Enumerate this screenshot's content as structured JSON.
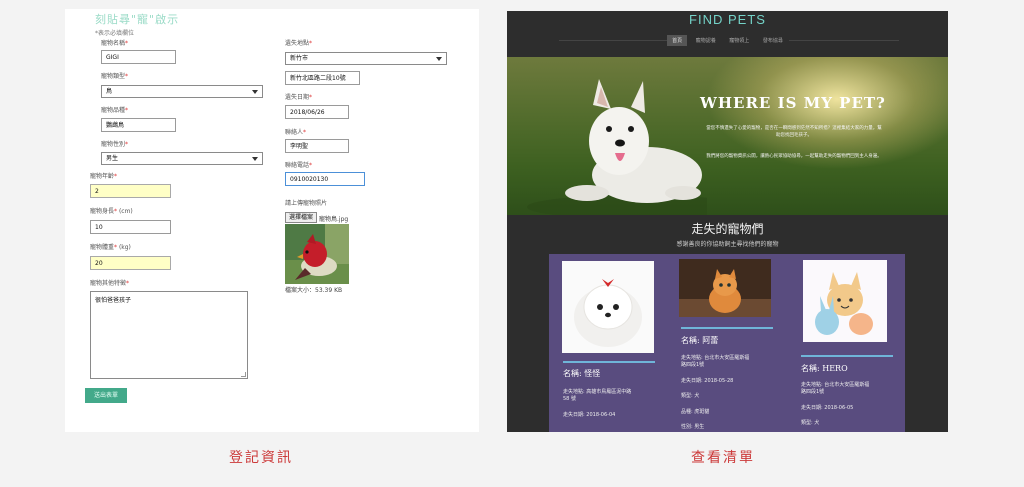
{
  "form": {
    "title": "刻貼尋\"寵\"啟示",
    "required_note": "*表示必填欄位",
    "pet_name": {
      "label": "寵物名稱",
      "value": "GIGI"
    },
    "pet_type": {
      "label": "寵物類型",
      "value": "鳥"
    },
    "pet_breed": {
      "label": "寵物品種",
      "value": "鸚鵡鳥"
    },
    "pet_gender": {
      "label": "寵物性別",
      "value": "男生"
    },
    "pet_age": {
      "label": "寵物年齡",
      "value": "2"
    },
    "pet_height": {
      "label": "寵物身長",
      "unit": "(cm)",
      "value": "10"
    },
    "pet_weight": {
      "label": "寵物體重",
      "unit": "(kg)",
      "value": "20"
    },
    "pet_features": {
      "label": "寵物其他特徵",
      "value": "很怕爸爸孩子"
    },
    "lost_location": {
      "label": "遺失地點",
      "city": "新竹市",
      "address": "新竹北區路二段10號"
    },
    "lost_date": {
      "label": "遺失日期",
      "value": "2018/06/26"
    },
    "contact_name": {
      "label": "聯絡人",
      "value": "李明聖"
    },
    "contact_phone": {
      "label": "聯絡電話",
      "value": "0910020130"
    },
    "photo": {
      "label": "請上傳寵物照片",
      "button": "選擇檔案",
      "filename": "寵物鳥.jpg",
      "size": "檔案大小：53.39 KB"
    },
    "submit": "送出表單",
    "required_mark": "*"
  },
  "site": {
    "logo": "FIND PETS",
    "nav": [
      "首頁",
      "寵物認養",
      "寵物領上",
      "發布協尋"
    ],
    "hero_title": "WHERE IS MY PET?",
    "hero_text_1": "當您不慎遺失了心愛的寵物，是否在一瞬間感到茫然不知所措？這裡集結大家的力量，幫助您找回毛孩子。",
    "hero_text_2": "我們將您的寵物資訊公開，讓熱心民眾協助協尋，一起幫助走失的寵物們回到主人身邊。",
    "section_title": "走失的寵物們",
    "section_sub": "感謝善良的你協助飼主尋找他們的寵物",
    "cards": [
      {
        "name": "名稱: 怪怪",
        "lines": [
          "走失地點: 高雄市鳥鳳區泥中路",
          "58 號",
          "走失日期: 2018-06-04"
        ]
      },
      {
        "name": "名稱: 阿蕾",
        "lines": [
          "走失地點: 台北市大安區羅斯福",
          "路四段1號",
          "走失日期: 2018-05-28",
          "類型: 犬",
          "品種: 虎斑貓",
          "性別: 男生"
        ]
      },
      {
        "name": "名稱: HERO",
        "lines": [
          "走失地點: 台北市大安區羅斯福",
          "路四段1號",
          "走失日期: 2018-06-05",
          "類型: 犬"
        ]
      }
    ]
  },
  "captions": {
    "left": "登記資訊",
    "right": "查看清單"
  }
}
